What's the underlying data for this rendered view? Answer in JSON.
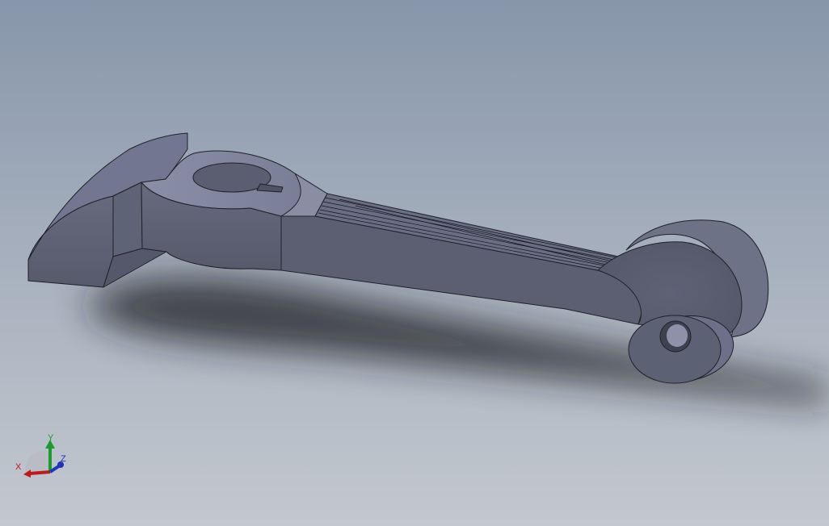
{
  "viewport": {
    "background_top": "#8796aa",
    "background_bottom": "#c3c8cf"
  },
  "model": {
    "part_color": "#5d6172",
    "top_face_color": "#7d8199",
    "edge_color": "#202128"
  },
  "triad": {
    "x_label": "X",
    "y_label": "Y",
    "z_label": "Z",
    "x_color": "#c0181b",
    "y_color": "#1a9c2c",
    "z_color": "#2233bb"
  }
}
